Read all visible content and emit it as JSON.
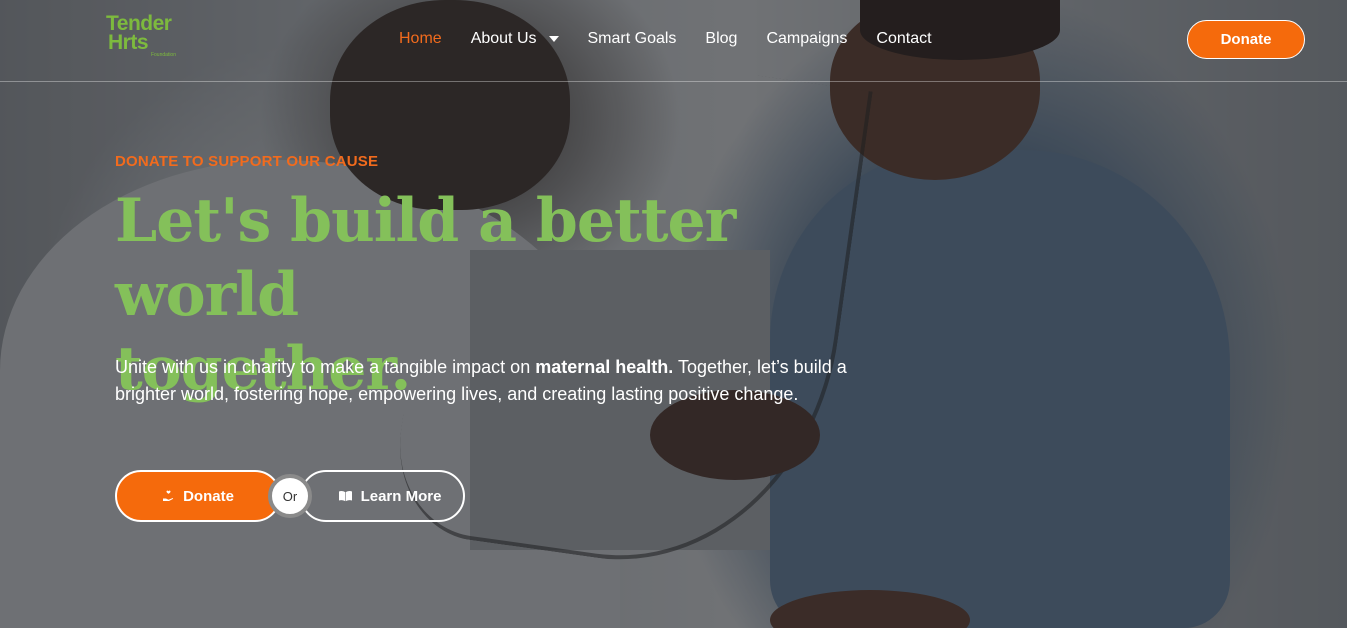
{
  "brand": {
    "line1": "Tender",
    "line2": "Hrts",
    "sub": "Foundation",
    "color": "#7dba3e"
  },
  "nav": {
    "items": [
      {
        "label": "Home",
        "active": true
      },
      {
        "label": "About Us",
        "has_dropdown": true
      },
      {
        "label": "Smart Goals"
      },
      {
        "label": "Blog"
      },
      {
        "label": "Campaigns"
      },
      {
        "label": "Contact"
      }
    ],
    "donate_label": "Donate"
  },
  "hero": {
    "eyebrow": "DONATE TO SUPPORT OUR CAUSE",
    "headline_line1": "Let's build a better world",
    "headline_line2": "together.",
    "lead_before": "Unite with us in charity to make a tangible impact on ",
    "lead_strong": "maternal health.",
    "lead_after": " Together, let’s build a brighter world, fostering hope, empowering lives, and creating lasting positive change.",
    "cta_donate": "Donate",
    "cta_or": "Or",
    "cta_learn": "Learn More",
    "donate_icon": "hand-heart-icon",
    "learn_icon": "book-icon"
  },
  "colors": {
    "accent_orange": "#f56a0c",
    "headline_green": "#84c05a",
    "nav_active": "#f26b1d"
  }
}
